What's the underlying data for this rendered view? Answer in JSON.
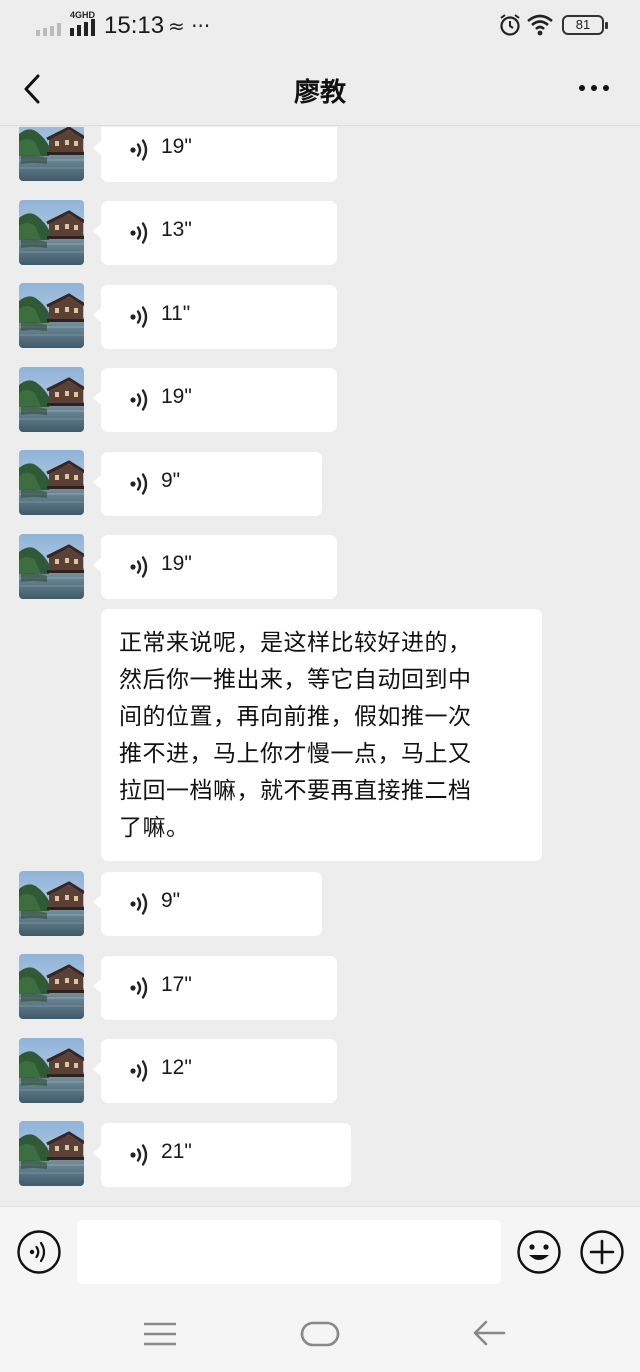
{
  "status_bar": {
    "network": "4GHD",
    "time": "15:13",
    "extra": "≈ ···",
    "battery": "81",
    "icons": [
      "signal-icon",
      "alarm-icon",
      "wifi-icon",
      "battery-icon"
    ]
  },
  "header": {
    "title": "廖教",
    "icons": [
      "back-arrow-icon",
      "more-icon"
    ]
  },
  "messages": [
    {
      "type": "voice",
      "duration": "19\""
    },
    {
      "type": "voice",
      "duration": "13\""
    },
    {
      "type": "voice",
      "duration": "11\""
    },
    {
      "type": "voice",
      "duration": "19\""
    },
    {
      "type": "voice",
      "duration": "9\""
    },
    {
      "type": "voice",
      "duration": "19\""
    },
    {
      "type": "text",
      "lines": [
        "正常来说呢，是这样比较好进的，",
        "然后你一推出来，等它自动回到中",
        "间的位置，再向前推，假如推一次",
        "推不进，马上你才慢一点，马上又",
        "拉回一档嘛，就不要再直接推二档",
        "了嘛。"
      ]
    },
    {
      "type": "voice",
      "duration": "9\""
    },
    {
      "type": "voice",
      "duration": "17\""
    },
    {
      "type": "voice",
      "duration": "12\""
    },
    {
      "type": "voice",
      "duration": "21\""
    }
  ],
  "input_bar": {
    "value": "",
    "icons": [
      "voice-mode-icon",
      "emoji-icon",
      "plus-icon"
    ]
  },
  "nav_bar": {
    "icons": [
      "menu-icon",
      "home-icon",
      "back-icon"
    ]
  },
  "colors": {
    "background": "#ededed",
    "bubble": "#ffffff",
    "input_bar": "#f5f5f5"
  }
}
